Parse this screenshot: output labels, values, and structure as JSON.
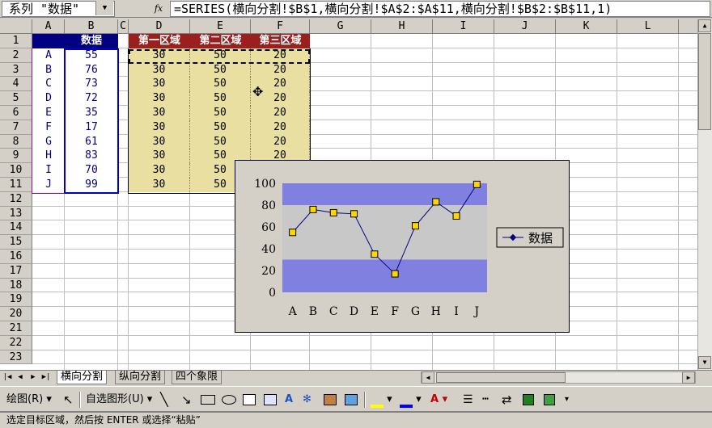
{
  "name_box": "系列 \"数据\"",
  "formula": "=SERIES(横向分割!$B$1,横向分割!$A$2:$A$11,横向分割!$B$2:$B$11,1)",
  "icons": {
    "fx": "fx-icon",
    "dropdown": "chevron-down-icon"
  },
  "columns": [
    "A",
    "B",
    "C",
    "D",
    "E",
    "F",
    "G",
    "H",
    "I",
    "J",
    "K",
    "L"
  ],
  "rows": [
    "1",
    "2",
    "3",
    "4",
    "5",
    "6",
    "7",
    "8",
    "9",
    "10",
    "11",
    "12",
    "13",
    "14",
    "15",
    "16",
    "17",
    "18",
    "19",
    "20",
    "21",
    "22",
    "23"
  ],
  "header_b": "数据",
  "header_d": "第一区域",
  "header_e": "第二区域",
  "header_f": "第三区域",
  "labels": [
    "A",
    "B",
    "C",
    "D",
    "E",
    "F",
    "G",
    "H",
    "I",
    "J"
  ],
  "data_values": [
    "55",
    "76",
    "73",
    "72",
    "35",
    "17",
    "61",
    "83",
    "70",
    "99"
  ],
  "zone1": "30",
  "zone2": "50",
  "zone3": "20",
  "colors": {
    "header_blue": "#000080",
    "header_red": "#9a1f1f",
    "band_fill": "#e8dfa0",
    "band_blue": "#8080e0",
    "plot_bg": "#c8c8c8",
    "line": "#000080",
    "marker": "#ffd700"
  },
  "sheet_tabs": [
    "横向分割",
    "纵向分割",
    "四个象限"
  ],
  "active_tab": 0,
  "toolbar": {
    "draw": "绘图(R)",
    "autoshape": "自选图形(U)"
  },
  "status": "选定目标区域，然后按 ENTER 或选择“粘贴”",
  "chart_data": {
    "type": "line",
    "categories": [
      "A",
      "B",
      "C",
      "D",
      "E",
      "F",
      "G",
      "H",
      "I",
      "J"
    ],
    "series": [
      {
        "name": "数据",
        "values": [
          55,
          76,
          73,
          72,
          35,
          17,
          61,
          83,
          70,
          99
        ]
      }
    ],
    "bands": [
      {
        "from": 0,
        "to": 30
      },
      {
        "from": 30,
        "to": 80
      },
      {
        "from": 80,
        "to": 100
      }
    ],
    "ylim": [
      0,
      100
    ],
    "yticks": [
      "0",
      "20",
      "40",
      "60",
      "80",
      "100"
    ],
    "legend": "right"
  }
}
